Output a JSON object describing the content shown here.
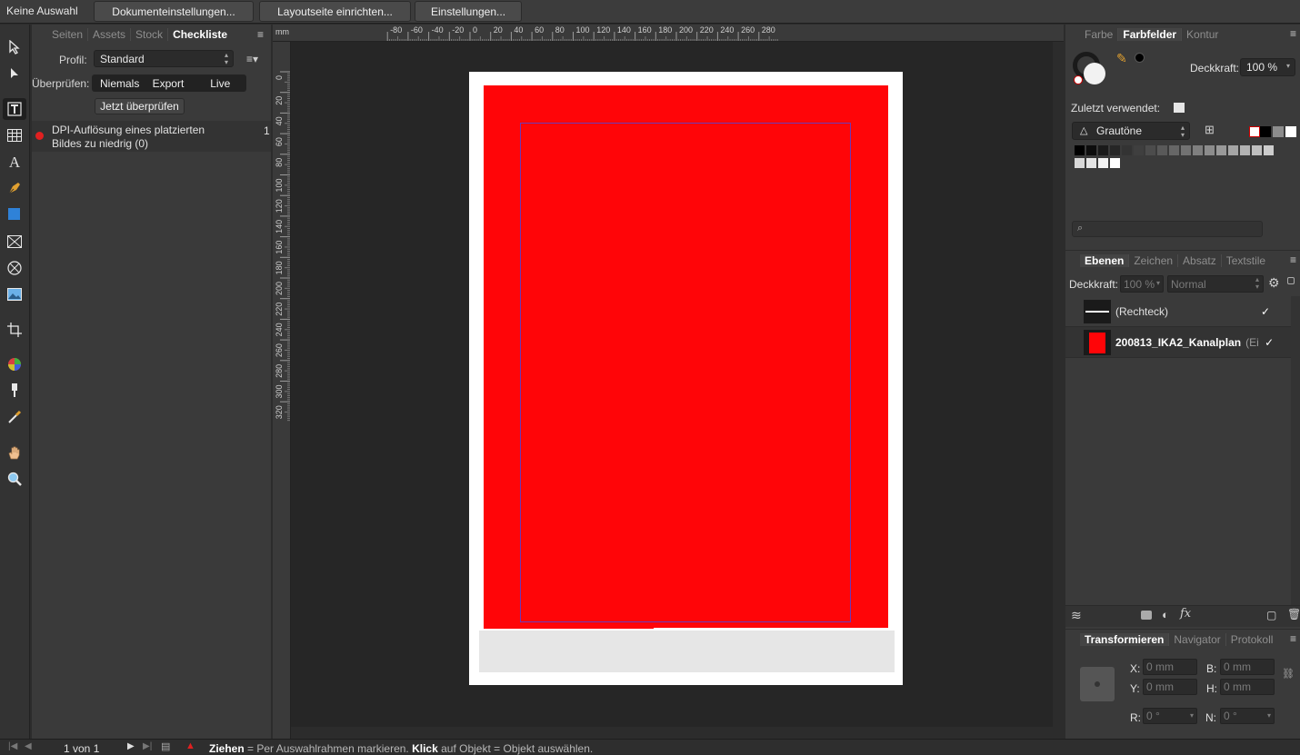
{
  "context_bar": {
    "selection": "Keine Auswahl",
    "buttons": [
      "Dokumenteinstellungen...",
      "Layoutseite einrichten...",
      "Einstellungen..."
    ]
  },
  "left_panel": {
    "tabs": [
      "Seiten",
      "Assets",
      "Stock",
      "Checkliste"
    ],
    "active_tab": "Checkliste",
    "profile_label": "Profil:",
    "profile_value": "Standard",
    "check_label": "Überprüfen:",
    "check_options": [
      "Niemals",
      "Export",
      "Live"
    ],
    "check_selected": "Live",
    "check_now_button": "Jetzt überprüfen",
    "issues": [
      {
        "text_line1": "DPI-Auflösung eines platzierten",
        "text_line2": "Bildes zu niedrig (0)",
        "count": "1",
        "status_color": "#e02020"
      }
    ]
  },
  "ruler": {
    "unit": "mm",
    "h_ticks": [
      "-80",
      "-60",
      "-40",
      "-20",
      "0",
      "20",
      "40",
      "60",
      "80",
      "100",
      "120",
      "140",
      "160",
      "180",
      "200",
      "220",
      "240",
      "260",
      "280"
    ],
    "v_ticks": [
      "0",
      "20",
      "40",
      "60",
      "80",
      "100",
      "120",
      "140",
      "160",
      "180",
      "200",
      "220",
      "240",
      "260",
      "280",
      "300",
      "320"
    ]
  },
  "right_panel": {
    "color_tabs": [
      "Farbe",
      "Farbfelder",
      "Kontur"
    ],
    "active_color_tab": "Farbfelder",
    "opacity_label": "Deckkraft:",
    "opacity_value": "100 %",
    "recent_label": "Zuletzt verwendet:",
    "palette_name": "Grautöne",
    "swatches_row1": [
      "#000000",
      "#0d0d0d",
      "#1a1a1a",
      "#262626",
      "#333333",
      "#3f3f3f",
      "#4c4c4c",
      "#595959",
      "#666666",
      "#727272",
      "#7f7f7f",
      "#8c8c8c",
      "#999999",
      "#a5a5a5",
      "#b2b2b2",
      "#bfbfbf",
      "#cccccc"
    ],
    "swatches_row2": [
      "#d8d8d8",
      "#e5e5e5",
      "#f2f2f2",
      "#ffffff"
    ],
    "search_placeholder": "",
    "layer_tabs": [
      "Ebenen",
      "Zeichen",
      "Absatz",
      "Textstile"
    ],
    "active_layer_tab": "Ebenen",
    "layer_opacity_label": "Deckkraft:",
    "layer_opacity_value": "100 %",
    "blend_mode": "Normal",
    "layers": [
      {
        "name": "(Rechteck)",
        "bold": false,
        "checked": "✓"
      },
      {
        "name": "200813_IKA2_Kanalplan",
        "suffix": "(Ei",
        "bold": true,
        "checked": "✓"
      }
    ],
    "transform_tabs": [
      "Transformieren",
      "Navigator",
      "Protokoll"
    ],
    "active_transform_tab": "Transformieren",
    "transform": {
      "x_label": "X:",
      "x_value": "0 mm",
      "y_label": "Y:",
      "y_value": "0 mm",
      "b_label": "B:",
      "b_value": "0 mm",
      "h_label": "H:",
      "h_value": "0 mm",
      "r_label": "R:",
      "r_value": "0 °",
      "n_label": "N:",
      "n_value": "0 °"
    }
  },
  "status_bar": {
    "page": "1 von 1",
    "hint_bold1": "Ziehen",
    "hint1": " = Per Auswahlrahmen markieren. ",
    "hint_bold2": "Klick",
    "hint2": " auf Objekt = Objekt auswählen."
  },
  "colors": {
    "accent_red": "#ff0508",
    "page": "#ffffff",
    "bottom_bar": "#e6e6e6",
    "margin_guide": "#6b3ab8"
  }
}
